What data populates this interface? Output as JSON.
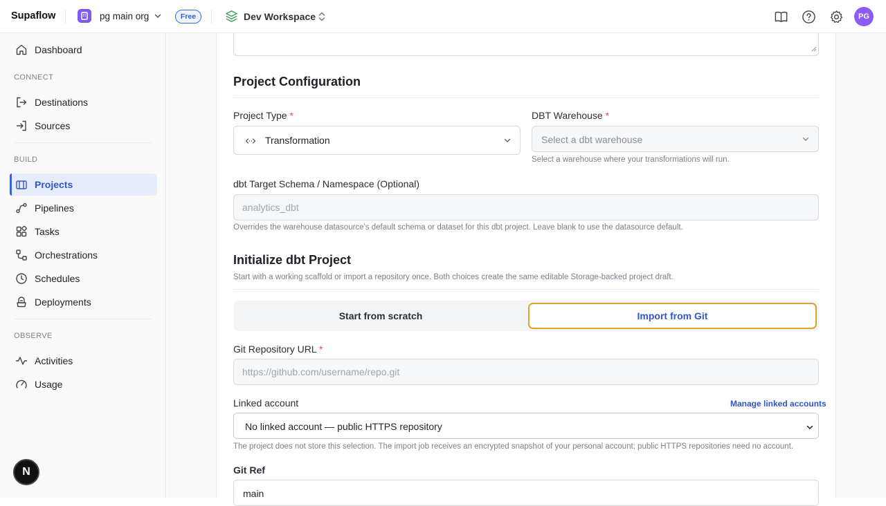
{
  "header": {
    "brand": "Supaflow",
    "org_name": "pg main org",
    "plan_badge": "Free",
    "workspace": "Dev Workspace",
    "avatar_initials": "PG",
    "icons": [
      "book-icon",
      "help-icon",
      "gear-icon"
    ]
  },
  "sidebar": {
    "dashboard": "Dashboard",
    "sections": {
      "connect": "CONNECT",
      "build": "BUILD",
      "observe": "OBSERVE"
    },
    "connect_items": [
      {
        "label": "Destinations",
        "icon": "destination-icon"
      },
      {
        "label": "Sources",
        "icon": "source-icon"
      }
    ],
    "build_items": [
      {
        "label": "Projects",
        "icon": "projects-icon",
        "active": true
      },
      {
        "label": "Pipelines",
        "icon": "pipelines-icon"
      },
      {
        "label": "Tasks",
        "icon": "tasks-icon"
      },
      {
        "label": "Orchestrations",
        "icon": "orchestrations-icon"
      },
      {
        "label": "Schedules",
        "icon": "clock-icon"
      },
      {
        "label": "Deployments",
        "icon": "deployments-icon"
      }
    ],
    "observe_items": [
      {
        "label": "Activities",
        "icon": "activity-icon"
      },
      {
        "label": "Usage",
        "icon": "gauge-icon"
      }
    ],
    "dev_badge": "N"
  },
  "project_config": {
    "heading": "Project Configuration",
    "project_type_label": "Project Type",
    "project_type_value": "Transformation",
    "warehouse_label": "DBT Warehouse",
    "warehouse_placeholder": "Select a dbt warehouse",
    "warehouse_help": "Select a warehouse where your transformations will run.",
    "schema_label": "dbt Target Schema / Namespace (Optional)",
    "schema_placeholder": "analytics_dbt",
    "schema_help": "Overrides the warehouse datasource's default schema or dataset for this dbt project. Leave blank to use the datasource default."
  },
  "init": {
    "heading": "Initialize dbt Project",
    "description": "Start with a working scaffold or import a repository once. Both choices create the same editable Storage-backed project draft.",
    "option_scratch": "Start from scratch",
    "option_git": "Import from Git",
    "git_url_label": "Git Repository URL",
    "git_url_placeholder": "https://github.com/username/repo.git",
    "linked_label": "Linked account",
    "manage_link": "Manage linked accounts",
    "linked_value": "No linked account — public HTTPS repository",
    "linked_help": "The project does not store this selection. The import job receives an encrypted snapshot of your personal account; public HTTPS repositories need no account.",
    "git_ref_label": "Git Ref",
    "git_ref_value": "main"
  },
  "required_marker": "*"
}
